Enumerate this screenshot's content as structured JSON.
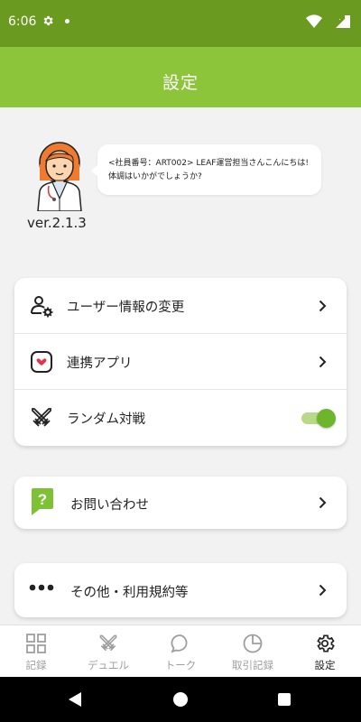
{
  "status_bar": {
    "time": "6:06"
  },
  "app_bar": {
    "title": "設定"
  },
  "profile": {
    "message_line1": "<社員番号：ART002> LEAF運営担当さんこんにちは!",
    "message_line2": "体調はいかがでしょうか?",
    "version": "ver.2.1.3"
  },
  "settings": {
    "items": [
      {
        "label": "ユーザー情報の変更",
        "icon": "user-settings-icon"
      },
      {
        "label": "連携アプリ",
        "icon": "health-app-icon"
      },
      {
        "label": "ランダム対戦",
        "icon": "crossed-swords-icon",
        "toggle": true
      }
    ]
  },
  "contact": {
    "label": "お問い合わせ",
    "icon": "help-bubble-icon"
  },
  "other": {
    "label": "その他・利用規約等",
    "icon": "more-dots-icon"
  },
  "bottom_nav": {
    "items": [
      {
        "label": "記録",
        "icon": "grid-icon"
      },
      {
        "label": "デュエル",
        "icon": "crossed-swords-icon"
      },
      {
        "label": "トーク",
        "icon": "chat-bubble-icon"
      },
      {
        "label": "取引記録",
        "icon": "pie-chart-icon"
      },
      {
        "label": "設定",
        "icon": "gear-icon",
        "active": true
      }
    ]
  },
  "colors": {
    "status_bar": "#6a9a1f",
    "app_bar": "#8cc43a",
    "toggle_on": "#6fb52c",
    "accent_green": "#7cc234"
  }
}
